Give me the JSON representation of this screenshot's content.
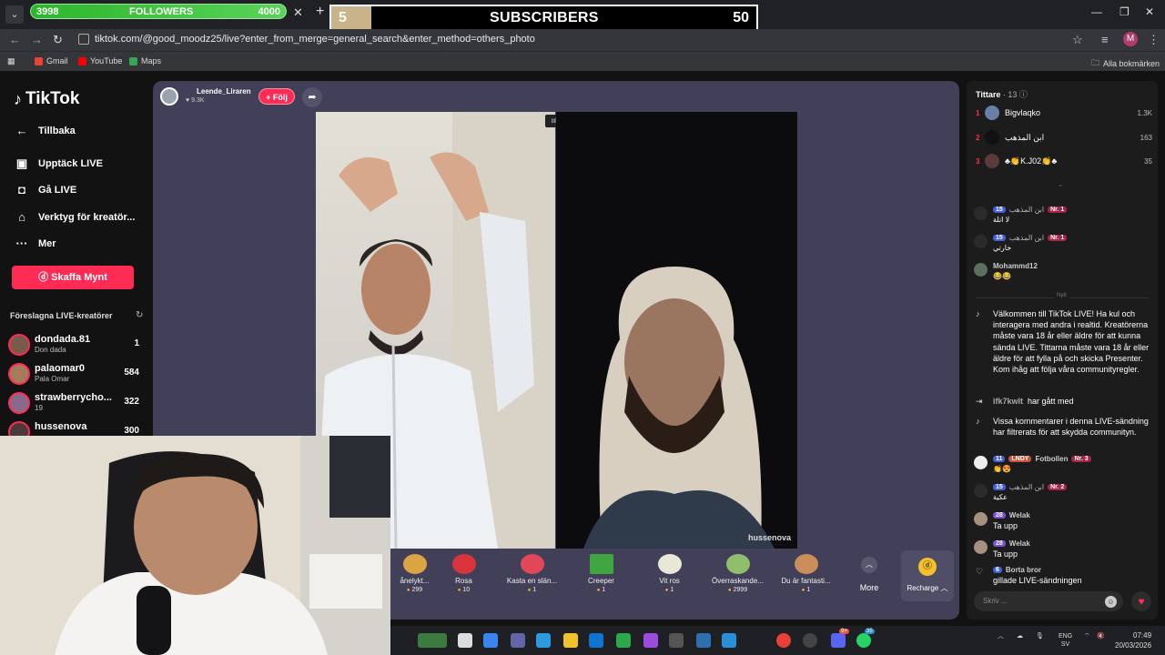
{
  "browser": {
    "followers": {
      "current": "3998",
      "label": "FOLLOWERS",
      "goal": "4000",
      "progress_fraction": 0.9995
    },
    "subscribers": {
      "count": "5",
      "label": "SUBSCRIBERS",
      "goal": "50",
      "progress_fraction": 0.1
    },
    "url": "tiktok.com/@good_moodz25/live?enter_from_merge=general_search&enter_method=others_photo",
    "profile_initial": "M",
    "bookmarks": [
      "Gmail",
      "YouTube",
      "Maps"
    ],
    "all_bookmarks": "Alla bokmärken"
  },
  "sidebar": {
    "logo": "TikTok",
    "back": "Tillbaka",
    "nav": [
      "Upptäck LIVE",
      "Gå LIVE",
      "Verktyg för kreatör...",
      "Mer"
    ],
    "coins_button": "Skaffa Mynt",
    "suggested_title": "Föreslagna LIVE-kreatörer",
    "creators": [
      {
        "name": "dondada.81",
        "sub": "Don dada",
        "count": "1"
      },
      {
        "name": "palaomar0",
        "sub": "Pala Omar",
        "count": "584"
      },
      {
        "name": "strawberrycho...",
        "sub": "19",
        "count": "322"
      },
      {
        "name": "hussenova",
        "sub": "",
        "count": "300"
      }
    ]
  },
  "stage": {
    "host_name": "Leende_Liraren",
    "host_likes": "9.3K",
    "follow_label": "+ Följ",
    "guest_label": "hussenova",
    "gifts": [
      {
        "name": "ånelykt...",
        "price": "299",
        "color": "#d9a441"
      },
      {
        "name": "Rosa",
        "price": "10",
        "color": "#d9343c"
      },
      {
        "name": "Kasta en slän...",
        "price": "1",
        "color": "#e0485a"
      },
      {
        "name": "Creeper",
        "price": "1",
        "color": "#3fa540"
      },
      {
        "name": "Vit ros",
        "price": "1",
        "color": "#e9e7d8"
      },
      {
        "name": "Överraskande...",
        "price": "2999",
        "color": "#8fbf6a"
      },
      {
        "name": "Du är fantasti...",
        "price": "1",
        "color": "#c98e5a"
      }
    ],
    "more_label": "More",
    "recharge_label": "Recharge"
  },
  "chat": {
    "viewers_title": "Tittare",
    "viewers_count": "13",
    "top_viewers": [
      {
        "rank": "1",
        "name": "Bigvlaqko",
        "score": "1.3K",
        "color": "#6a7fa8"
      },
      {
        "rank": "2",
        "name": "ابن المذهب",
        "score": "163",
        "color": "#111111"
      },
      {
        "rank": "3",
        "name": "♣👏K.J02👏♣",
        "score": "35",
        "color": "#5b3a3a"
      }
    ],
    "new_label": "Nytt",
    "messages": [
      {
        "lvl": "15",
        "name": "ابن المذهب",
        "nr": "Nr. 1",
        "body": "لا اتلة"
      },
      {
        "lvl": "15",
        "name": "ابن المذهب",
        "nr": "Nr. 1",
        "body": "خارتي"
      },
      {
        "lvl": "",
        "name": "Mohammd12",
        "nr": "",
        "body": "😂😂"
      }
    ],
    "welcome": "Välkommen till TikTok LIVE! Ha kul och interagera med andra i realtid. Kreatörerna måste vara 18 år eller äldre för att kunna sända LIVE. Tittarna måste vara 18 år eller äldre för att fylla på och skicka Presenter. Kom ihåg att följa våra communityregler.",
    "joined_user": "ifk7kwlt",
    "joined_text": "har gått med",
    "filter_notice": "Vissa kommentarer i denna LIVE-sändning har filtrerats för att skydda communityn.",
    "messages2": [
      {
        "lvl": "11",
        "team": "LNDY",
        "name": "Fotbollen",
        "nr": "Nr. 3",
        "body": "👏😍"
      },
      {
        "lvl": "15",
        "team": "",
        "name": "ابن المذهب",
        "nr": "Nr. 2",
        "body": "عكية"
      },
      {
        "lvl": "28",
        "team": "",
        "name": "Welak",
        "nr": "",
        "body": "Ta upp"
      },
      {
        "lvl": "28",
        "team": "",
        "name": "Welak",
        "nr": "",
        "body": "Ta upp"
      }
    ],
    "liked_user": "Borta bror",
    "liked_lvl": "6",
    "liked_text": "gillade LIVE-sändningen",
    "input_placeholder": "Skriv ..."
  },
  "taskbar": {
    "lang": "ENG",
    "lang2": "SV",
    "time": "07:49",
    "date": "20/03/2026",
    "badge_discord": "9+",
    "badge_whatsapp": "35"
  },
  "colors": {
    "accent": "#fe2c55",
    "stage": "#424058",
    "coin": "#f5c12b"
  }
}
